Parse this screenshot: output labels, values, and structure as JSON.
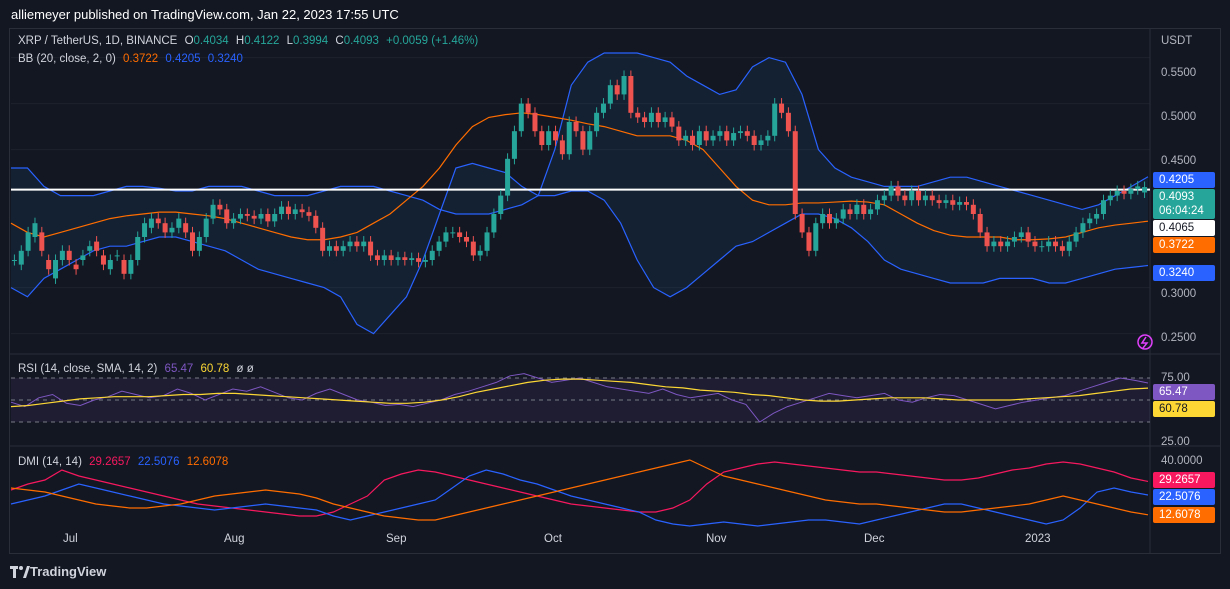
{
  "header": {
    "published_by": "alliemeyer published on TradingView.com, Jan 22, 2023 17:55 UTC"
  },
  "legend_main": {
    "symbol": "XRP / TetherUS, 1D, BINANCE",
    "o_label": "O",
    "o": "0.4034",
    "h_label": "H",
    "h": "0.4122",
    "l_label": "L",
    "l": "0.3994",
    "c_label": "C",
    "c": "0.4093",
    "change": "+0.0059 (+1.46%)",
    "bb_label": "BB (20, close, 2, 0)",
    "bb_mid": "0.3722",
    "bb_upper": "0.4205",
    "bb_lower": "0.3240"
  },
  "legend_rsi": {
    "label": "RSI (14, close, SMA, 14, 2)",
    "rsi": "65.47",
    "sma": "60.78",
    "extra": "ø  ø"
  },
  "legend_dmi": {
    "label": "DMI (14, 14)",
    "plus": "29.2657",
    "minus": "22.5076",
    "adx": "12.6078"
  },
  "price_axis": {
    "currency": "USDT",
    "ticks": [
      "0.5500",
      "0.5000",
      "0.4500",
      "0.3000",
      "0.2500"
    ],
    "tags": {
      "bb_upper": "0.4205",
      "last": "0.4093",
      "countdown": "06:04:24",
      "line": "0.4065",
      "bb_mid": "0.3722",
      "bb_lower": "0.3240"
    }
  },
  "rsi_axis": {
    "ticks": [
      "75.00",
      "25.00"
    ],
    "tags": {
      "rsi": "65.47",
      "sma": "60.78"
    }
  },
  "dmi_axis": {
    "ticks": [
      "40.0000"
    ],
    "tags": {
      "plus": "29.2657",
      "minus": "22.5076",
      "adx": "12.6078"
    }
  },
  "time_axis": {
    "labels": [
      "Jul",
      "Aug",
      "Sep",
      "Oct",
      "Nov",
      "Dec",
      "2023"
    ]
  },
  "footer": {
    "brand": "TradingView"
  },
  "colors": {
    "up": "#26a69a",
    "down": "#ef5350",
    "bb_upper": "#2962ff",
    "bb_lower": "#2962ff",
    "bb_mid": "#ff6d00",
    "rsi": "#7e57c2",
    "rsi_sma": "#fdd835",
    "dmi_plus": "#f7185f",
    "dmi_minus": "#2962ff",
    "dmi_adx": "#ff6d00"
  },
  "chart_data": {
    "type": "candlestick",
    "symbol": "XRP / TetherUS",
    "interval": "1D",
    "ylim": [
      0.23,
      0.58
    ],
    "horizontal_line": 0.4065,
    "price_path": [
      [
        0.33,
        0.33
      ],
      [
        0.34,
        0.325
      ],
      [
        0.36,
        0.34
      ],
      [
        0.37,
        0.355
      ],
      [
        0.34,
        0.36
      ],
      [
        0.32,
        0.33
      ],
      [
        0.33,
        0.31
      ],
      [
        0.34,
        0.33
      ],
      [
        0.33,
        0.34
      ],
      [
        0.32,
        0.325
      ],
      [
        0.335,
        0.33
      ],
      [
        0.345,
        0.34
      ],
      [
        0.34,
        0.35
      ],
      [
        0.325,
        0.335
      ],
      [
        0.33,
        0.32
      ],
      [
        0.335,
        0.335
      ],
      [
        0.315,
        0.33
      ],
      [
        0.33,
        0.315
      ],
      [
        0.355,
        0.33
      ],
      [
        0.37,
        0.355
      ],
      [
        0.375,
        0.365
      ],
      [
        0.37,
        0.375
      ],
      [
        0.36,
        0.37
      ],
      [
        0.365,
        0.36
      ],
      [
        0.375,
        0.365
      ],
      [
        0.36,
        0.37
      ],
      [
        0.34,
        0.36
      ],
      [
        0.355,
        0.34
      ],
      [
        0.375,
        0.355
      ],
      [
        0.39,
        0.375
      ],
      [
        0.385,
        0.39
      ],
      [
        0.37,
        0.385
      ],
      [
        0.375,
        0.37
      ],
      [
        0.38,
        0.375
      ],
      [
        0.378,
        0.38
      ],
      [
        0.375,
        0.378
      ],
      [
        0.38,
        0.375
      ],
      [
        0.372,
        0.38
      ],
      [
        0.38,
        0.372
      ],
      [
        0.388,
        0.38
      ],
      [
        0.38,
        0.388
      ],
      [
        0.385,
        0.38
      ],
      [
        0.382,
        0.385
      ],
      [
        0.378,
        0.382
      ],
      [
        0.365,
        0.378
      ],
      [
        0.34,
        0.365
      ],
      [
        0.345,
        0.34
      ],
      [
        0.34,
        0.345
      ],
      [
        0.345,
        0.34
      ],
      [
        0.35,
        0.345
      ],
      [
        0.345,
        0.35
      ],
      [
        0.35,
        0.345
      ],
      [
        0.335,
        0.35
      ],
      [
        0.33,
        0.335
      ],
      [
        0.335,
        0.33
      ],
      [
        0.33,
        0.335
      ],
      [
        0.333,
        0.33
      ],
      [
        0.33,
        0.333
      ],
      [
        0.332,
        0.33
      ],
      [
        0.328,
        0.332
      ],
      [
        0.33,
        0.328
      ],
      [
        0.34,
        0.33
      ],
      [
        0.35,
        0.34
      ],
      [
        0.36,
        0.35
      ],
      [
        0.36,
        0.36
      ],
      [
        0.355,
        0.36
      ],
      [
        0.35,
        0.355
      ],
      [
        0.335,
        0.35
      ],
      [
        0.34,
        0.335
      ],
      [
        0.36,
        0.34
      ],
      [
        0.38,
        0.36
      ],
      [
        0.4,
        0.38
      ],
      [
        0.44,
        0.4
      ],
      [
        0.47,
        0.44
      ],
      [
        0.5,
        0.47
      ],
      [
        0.49,
        0.5
      ],
      [
        0.47,
        0.49
      ],
      [
        0.455,
        0.47
      ],
      [
        0.47,
        0.455
      ],
      [
        0.46,
        0.47
      ],
      [
        0.445,
        0.46
      ],
      [
        0.48,
        0.445
      ],
      [
        0.47,
        0.48
      ],
      [
        0.45,
        0.47
      ],
      [
        0.47,
        0.45
      ],
      [
        0.49,
        0.47
      ],
      [
        0.5,
        0.49
      ],
      [
        0.52,
        0.5
      ],
      [
        0.51,
        0.52
      ],
      [
        0.53,
        0.51
      ],
      [
        0.49,
        0.53
      ],
      [
        0.485,
        0.49
      ],
      [
        0.48,
        0.485
      ],
      [
        0.49,
        0.48
      ],
      [
        0.48,
        0.49
      ],
      [
        0.485,
        0.48
      ],
      [
        0.475,
        0.485
      ],
      [
        0.46,
        0.475
      ],
      [
        0.465,
        0.46
      ],
      [
        0.455,
        0.465
      ],
      [
        0.47,
        0.455
      ],
      [
        0.46,
        0.47
      ],
      [
        0.465,
        0.46
      ],
      [
        0.47,
        0.465
      ],
      [
        0.46,
        0.47
      ],
      [
        0.468,
        0.46
      ],
      [
        0.47,
        0.468
      ],
      [
        0.465,
        0.47
      ],
      [
        0.455,
        0.465
      ],
      [
        0.46,
        0.455
      ],
      [
        0.465,
        0.46
      ],
      [
        0.5,
        0.465
      ],
      [
        0.49,
        0.5
      ],
      [
        0.47,
        0.49
      ],
      [
        0.38,
        0.47
      ],
      [
        0.36,
        0.38
      ],
      [
        0.34,
        0.36
      ],
      [
        0.37,
        0.34
      ],
      [
        0.38,
        0.37
      ],
      [
        0.37,
        0.38
      ],
      [
        0.375,
        0.37
      ],
      [
        0.385,
        0.375
      ],
      [
        0.38,
        0.385
      ],
      [
        0.39,
        0.38
      ],
      [
        0.38,
        0.39
      ],
      [
        0.385,
        0.38
      ],
      [
        0.395,
        0.385
      ],
      [
        0.4,
        0.395
      ],
      [
        0.41,
        0.4
      ],
      [
        0.4,
        0.41
      ],
      [
        0.395,
        0.4
      ],
      [
        0.405,
        0.395
      ],
      [
        0.395,
        0.405
      ],
      [
        0.4,
        0.395
      ],
      [
        0.395,
        0.4
      ],
      [
        0.392,
        0.395
      ],
      [
        0.395,
        0.392
      ],
      [
        0.39,
        0.395
      ],
      [
        0.393,
        0.39
      ],
      [
        0.39,
        0.393
      ],
      [
        0.38,
        0.39
      ],
      [
        0.36,
        0.38
      ],
      [
        0.345,
        0.36
      ],
      [
        0.35,
        0.345
      ],
      [
        0.345,
        0.35
      ],
      [
        0.35,
        0.345
      ],
      [
        0.355,
        0.35
      ],
      [
        0.36,
        0.355
      ],
      [
        0.35,
        0.36
      ],
      [
        0.345,
        0.35
      ],
      [
        0.345,
        0.345
      ],
      [
        0.35,
        0.345
      ],
      [
        0.345,
        0.35
      ],
      [
        0.34,
        0.345
      ],
      [
        0.35,
        0.34
      ],
      [
        0.36,
        0.35
      ],
      [
        0.37,
        0.36
      ],
      [
        0.375,
        0.37
      ],
      [
        0.38,
        0.375
      ],
      [
        0.395,
        0.38
      ],
      [
        0.4,
        0.395
      ],
      [
        0.405,
        0.4
      ],
      [
        0.402,
        0.405
      ],
      [
        0.407,
        0.402
      ],
      [
        0.41,
        0.407
      ],
      [
        0.4093,
        0.4034
      ]
    ],
    "bb_upper": [
      0.43,
      0.43,
      0.41,
      0.4,
      0.4,
      0.4,
      0.405,
      0.41,
      0.41,
      0.408,
      0.405,
      0.405,
      0.41,
      0.41,
      0.41,
      0.405,
      0.4,
      0.4,
      0.4,
      0.405,
      0.41,
      0.41,
      0.41,
      0.405,
      0.4,
      0.395,
      0.385,
      0.38,
      0.38,
      0.38,
      0.385,
      0.39,
      0.4,
      0.45,
      0.52,
      0.545,
      0.555,
      0.555,
      0.555,
      0.55,
      0.545,
      0.53,
      0.52,
      0.51,
      0.515,
      0.54,
      0.55,
      0.545,
      0.51,
      0.45,
      0.43,
      0.42,
      0.415,
      0.41,
      0.41,
      0.41,
      0.415,
      0.42,
      0.42,
      0.415,
      0.41,
      0.405,
      0.4,
      0.395,
      0.39,
      0.385,
      0.39,
      0.4,
      0.41,
      0.4205
    ],
    "bb_mid": [
      0.37,
      0.36,
      0.355,
      0.36,
      0.365,
      0.37,
      0.375,
      0.378,
      0.38,
      0.382,
      0.382,
      0.38,
      0.378,
      0.375,
      0.37,
      0.365,
      0.36,
      0.355,
      0.352,
      0.352,
      0.355,
      0.36,
      0.37,
      0.38,
      0.395,
      0.41,
      0.43,
      0.455,
      0.475,
      0.485,
      0.488,
      0.49,
      0.488,
      0.485,
      0.482,
      0.478,
      0.475,
      0.47,
      0.465,
      0.465,
      0.465,
      0.46,
      0.45,
      0.43,
      0.41,
      0.395,
      0.39,
      0.39,
      0.392,
      0.392,
      0.393,
      0.394,
      0.393,
      0.39,
      0.38,
      0.37,
      0.362,
      0.357,
      0.355,
      0.355,
      0.355,
      0.352,
      0.352,
      0.353,
      0.355,
      0.36,
      0.365,
      0.368,
      0.37,
      0.3722
    ],
    "bb_lower": [
      0.3,
      0.29,
      0.31,
      0.32,
      0.33,
      0.34,
      0.345,
      0.345,
      0.35,
      0.355,
      0.355,
      0.35,
      0.345,
      0.34,
      0.33,
      0.32,
      0.315,
      0.31,
      0.305,
      0.3,
      0.29,
      0.26,
      0.25,
      0.27,
      0.29,
      0.33,
      0.38,
      0.43,
      0.435,
      0.43,
      0.425,
      0.41,
      0.4,
      0.4,
      0.405,
      0.405,
      0.395,
      0.37,
      0.33,
      0.3,
      0.29,
      0.3,
      0.315,
      0.33,
      0.345,
      0.35,
      0.36,
      0.37,
      0.38,
      0.38,
      0.375,
      0.365,
      0.35,
      0.33,
      0.32,
      0.315,
      0.31,
      0.305,
      0.305,
      0.305,
      0.31,
      0.31,
      0.31,
      0.305,
      0.305,
      0.31,
      0.315,
      0.32,
      0.322,
      0.324
    ],
    "rsi": [
      48,
      44,
      52,
      55,
      47,
      45,
      50,
      53,
      58,
      55,
      52,
      54,
      60,
      56,
      50,
      55,
      60,
      58,
      62,
      57,
      52,
      50,
      56,
      60,
      55,
      50,
      48,
      45,
      46,
      44,
      47,
      50,
      55,
      58,
      62,
      66,
      72,
      74,
      70,
      66,
      68,
      70,
      66,
      62,
      60,
      58,
      56,
      60,
      55,
      52,
      54,
      56,
      50,
      46,
      30,
      38,
      44,
      48,
      52,
      56,
      54,
      52,
      54,
      56,
      50,
      48,
      52,
      55,
      54,
      50,
      46,
      42,
      45,
      48,
      50,
      52,
      54,
      58,
      62,
      66,
      70,
      68,
      65.47
    ],
    "rsi_sma": [
      44,
      45,
      47,
      49,
      51,
      52,
      53,
      53,
      53,
      54,
      55,
      55,
      56,
      56,
      55,
      54,
      53,
      52,
      51,
      50,
      49,
      48,
      47,
      47,
      48,
      50,
      53,
      57,
      60,
      63,
      66,
      68,
      69,
      69,
      68,
      67,
      66,
      64,
      62,
      61,
      59,
      58,
      57,
      55,
      54,
      52,
      50,
      49,
      49,
      50,
      51,
      52,
      52,
      52,
      51,
      50,
      50,
      50,
      50,
      51,
      52,
      53,
      54,
      56,
      58,
      60,
      60.78
    ],
    "dmi_plus": [
      25,
      28,
      30,
      35,
      32,
      30,
      28,
      26,
      24,
      22,
      20,
      18,
      17,
      16,
      15,
      14,
      13,
      12,
      12,
      14,
      18,
      22,
      30,
      33,
      35,
      34,
      32,
      30,
      28,
      26,
      24,
      22,
      20,
      18,
      17,
      16,
      15,
      14,
      14,
      16,
      20,
      28,
      34,
      36,
      38,
      39,
      38,
      37,
      36,
      35,
      34,
      34,
      33,
      32,
      31,
      30,
      30,
      31,
      33,
      35,
      36,
      38,
      39,
      38,
      36,
      34,
      31,
      29.2657
    ],
    "dmi_minus": [
      18,
      20,
      22,
      25,
      28,
      26,
      24,
      22,
      20,
      18,
      17,
      16,
      15,
      16,
      17,
      18,
      17,
      16,
      15,
      12,
      10,
      12,
      14,
      16,
      18,
      20,
      26,
      32,
      35,
      33,
      30,
      28,
      25,
      22,
      20,
      18,
      16,
      14,
      10,
      8,
      7,
      8,
      9,
      8,
      7,
      8,
      9,
      10,
      10,
      9,
      8,
      10,
      12,
      14,
      16,
      18,
      18,
      16,
      14,
      12,
      10,
      8,
      10,
      16,
      24,
      26,
      24,
      22.5076
    ],
    "dmi_adx": [
      26,
      25,
      24,
      22,
      20,
      18,
      17,
      16,
      16,
      17,
      18,
      20,
      22,
      23,
      24,
      25,
      24,
      23,
      21,
      18,
      16,
      14,
      12,
      11,
      10,
      10,
      12,
      14,
      16,
      18,
      20,
      22,
      24,
      26,
      28,
      30,
      32,
      34,
      36,
      38,
      40,
      36,
      32,
      30,
      28,
      26,
      24,
      22,
      20,
      19,
      18,
      18,
      17,
      16,
      15,
      14,
      14,
      15,
      16,
      17,
      18,
      20,
      22,
      20,
      18,
      16,
      14,
      12.6078
    ]
  }
}
